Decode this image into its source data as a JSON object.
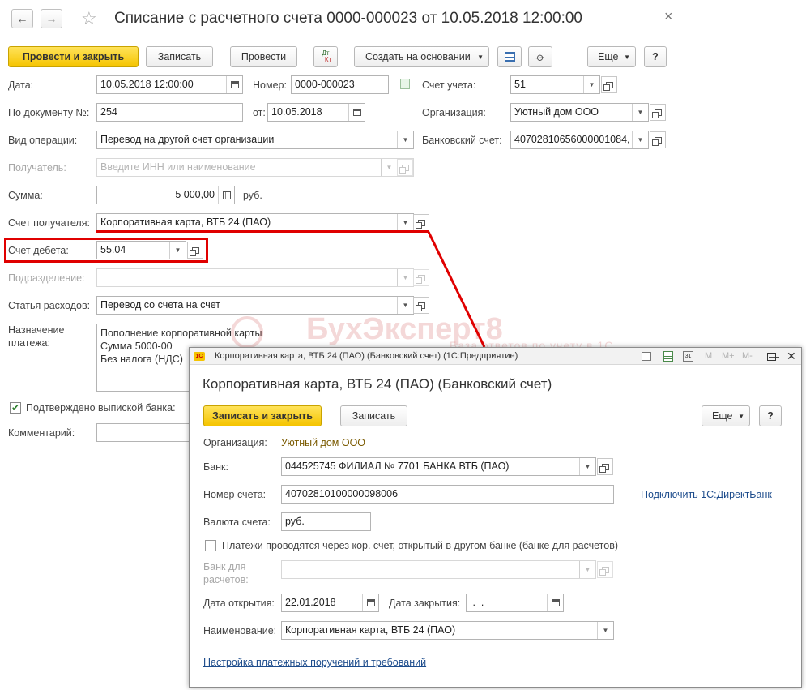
{
  "window": {
    "title": "Списание с расчетного счета 0000-000023 от 10.05.2018 12:00:00",
    "close": "×"
  },
  "toolbar": {
    "post_close": "Провести и закрыть",
    "save": "Записать",
    "post": "Провести",
    "dt_kt_top": "Дт",
    "dt_kt_bottom": "Кт",
    "create_based": "Создать на основании",
    "more": "Еще",
    "help": "?"
  },
  "form": {
    "date_label": "Дата:",
    "date_value": "10.05.2018 12:00:00",
    "number_label": "Номер:",
    "number_value": "0000-000023",
    "account_label": "Счет учета:",
    "account_value": "51",
    "doc_no_label": "По документу №:",
    "doc_no_value": "254",
    "from_label": "от:",
    "from_value": "10.05.2018",
    "org_label": "Организация:",
    "org_value": "Уютный дом ООО",
    "op_type_label": "Вид операции:",
    "op_type_value": "Перевод на другой счет организации",
    "bank_acc_label": "Банковский счет:",
    "bank_acc_value": "40702810656000001084, …",
    "recipient_label": "Получатель:",
    "recipient_placeholder": "Введите ИНН или наименование",
    "sum_label": "Сумма:",
    "sum_value": "5 000,00",
    "currency": "руб.",
    "recipient_acc_label": "Счет получателя:",
    "recipient_acc_value": "Корпоративная карта, ВТБ 24 (ПАО)",
    "debit_label": "Счет дебета:",
    "debit_value": "55.04",
    "division_label": "Подразделение:",
    "expense_label": "Статья расходов:",
    "expense_value": "Перевод со счета на счет",
    "purpose_label_1": "Назначение",
    "purpose_label_2": "платежа:",
    "purpose_line_1": "Пополнение корпоративной карты",
    "purpose_line_2": "Сумма 5000-00",
    "purpose_line_3": "Без налога (НДС)",
    "confirmed_label": "Подтверждено выпиской банка:",
    "comment_label": "Комментарий:"
  },
  "watermark": {
    "brand": "БухЭксперт8",
    "tagline": "База ответов по учету в 1С"
  },
  "popup": {
    "bar_logo": "1С",
    "bar_title": "Корпоративная карта, ВТБ 24 (ПАО) (Банковский счет)  (1С:Предприятие)",
    "bar_m": "M",
    "bar_mplus": "M+",
    "bar_mminus": "M-",
    "heading": "Корпоративная карта, ВТБ 24 (ПАО) (Банковский счет)",
    "save_close": "Записать и закрыть",
    "save": "Записать",
    "more": "Еще",
    "help": "?",
    "org_label": "Организация:",
    "org_value": "Уютный дом ООО",
    "bank_label": "Банк:",
    "bank_value": "044525745 ФИЛИАЛ № 7701 БАНКА ВТБ (ПАО)",
    "acc_no_label": "Номер счета:",
    "acc_no_value": "40702810100000098006",
    "direct_bank_link": "Подключить 1С:ДиректБанк",
    "currency_label": "Валюта счета:",
    "currency_value": "руб.",
    "corr_checkbox_label": "Платежи проводятся через кор. счет, открытый в другом банке (банке для расчетов)",
    "settle_bank_label_1": "Банк для",
    "settle_bank_label_2": "расчетов:",
    "open_date_label": "Дата открытия:",
    "open_date_value": "22.01.2018",
    "close_date_label": "Дата закрытия:",
    "close_date_value": " .  .",
    "name_label": "Наименование:",
    "name_value": "Корпоративная карта, ВТБ 24 (ПАО)",
    "settings_link": "Настройка платежных поручений и требований"
  },
  "colors": {
    "accent_yellow": "#f5c400",
    "highlight_red": "#e00000",
    "link_blue": "#1d4c8c"
  }
}
